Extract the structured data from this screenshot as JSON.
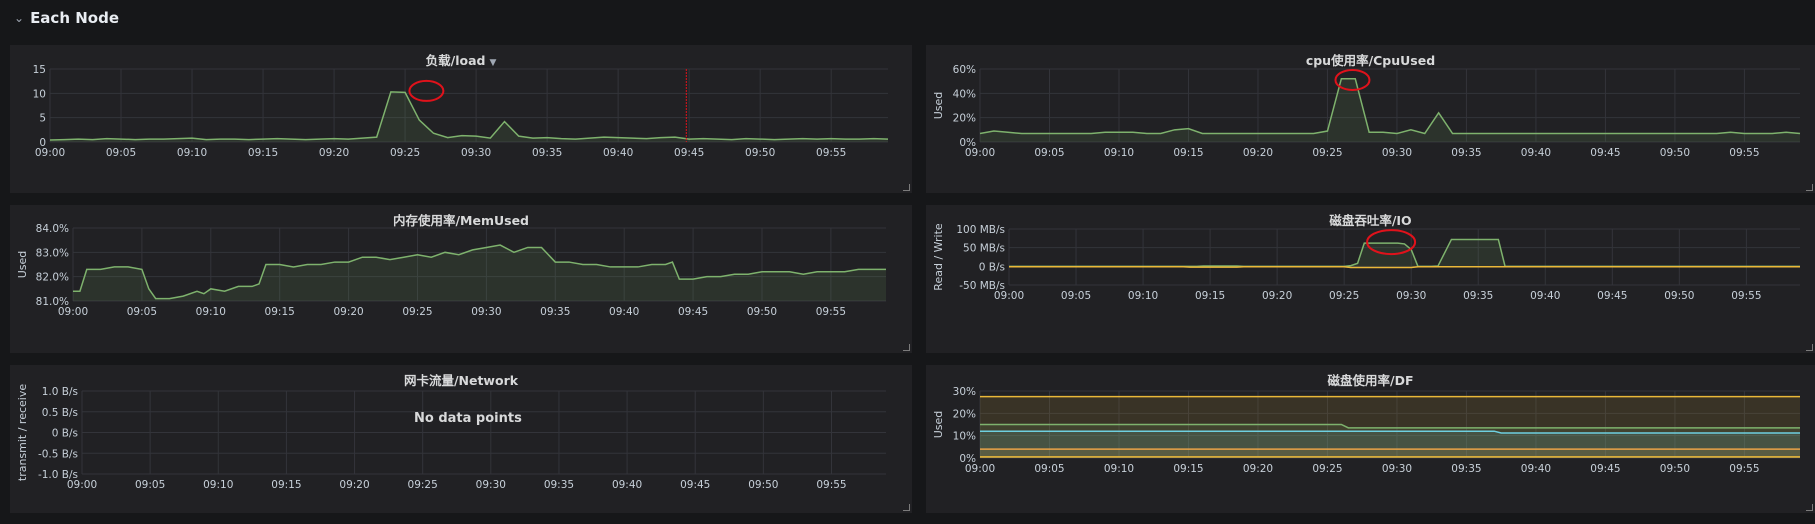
{
  "row": {
    "title": "Each Node",
    "icon": "chevron-down-icon"
  },
  "colors": {
    "green": "#7eb26d",
    "yellow": "#eab839",
    "blue": "#6ed0e0",
    "grid": "#33343a",
    "text": "#c7d0d9",
    "annotation": "#e0121b"
  },
  "panels": [
    {
      "id": "load",
      "title": "负载/load",
      "has_menu": true,
      "ylabel": "",
      "chart_data": {
        "type": "line",
        "yticks": [
          "0",
          "5",
          "10",
          "15"
        ],
        "ylim": [
          0,
          15
        ],
        "xticks": [
          "09:00",
          "09:05",
          "09:10",
          "09:15",
          "09:20",
          "09:25",
          "09:30",
          "09:35",
          "09:40",
          "09:45",
          "09:50",
          "09:55"
        ],
        "xlim_minutes": [
          0,
          59
        ],
        "series": [
          {
            "values_x": [
              0,
              1,
              2,
              3,
              4,
              5,
              6,
              7,
              8,
              9,
              10,
              11,
              12,
              13,
              14,
              15,
              16,
              17,
              18,
              19,
              20,
              21,
              22,
              23,
              24,
              25,
              26,
              27,
              28,
              29,
              30,
              31,
              32,
              33,
              34,
              35,
              36,
              37,
              38,
              39,
              40,
              41,
              42,
              43,
              44,
              45,
              46,
              47,
              48,
              49,
              50,
              51,
              52,
              53,
              54,
              55,
              56,
              57,
              58,
              59
            ],
            "values_y": [
              0.4,
              0.5,
              0.6,
              0.5,
              0.7,
              0.6,
              0.5,
              0.6,
              0.6,
              0.7,
              0.8,
              0.5,
              0.6,
              0.6,
              0.5,
              0.6,
              0.7,
              0.6,
              0.5,
              0.6,
              0.7,
              0.6,
              0.8,
              1.0,
              10.3,
              10.2,
              4.5,
              1.8,
              0.9,
              1.3,
              1.2,
              0.8,
              4.2,
              1.2,
              0.8,
              0.9,
              0.7,
              0.6,
              0.8,
              1.0,
              0.9,
              0.8,
              0.7,
              0.9,
              1.0,
              0.6,
              0.7,
              0.6,
              0.5,
              0.7,
              0.6,
              0.5,
              0.6,
              0.7,
              0.6,
              0.7,
              0.6,
              0.6,
              0.7,
              0.6
            ],
            "fill": true
          }
        ],
        "annotation_minute": 44.8,
        "circle_minute": 26.5,
        "circle_value": 10.5
      }
    },
    {
      "id": "cpu",
      "title": "cpu使用率/CpuUsed",
      "has_menu": false,
      "ylabel": "Used",
      "chart_data": {
        "type": "line",
        "yticks": [
          "0%",
          "20%",
          "40%",
          "60%"
        ],
        "ylim": [
          0,
          60
        ],
        "xticks": [
          "09:00",
          "09:05",
          "09:10",
          "09:15",
          "09:20",
          "09:25",
          "09:30",
          "09:35",
          "09:40",
          "09:45",
          "09:50",
          "09:55"
        ],
        "xlim_minutes": [
          0,
          59
        ],
        "series": [
          {
            "values_x": [
              0,
              1,
              2,
              3,
              4,
              5,
              6,
              7,
              8,
              9,
              10,
              11,
              12,
              13,
              14,
              15,
              16,
              17,
              18,
              19,
              20,
              21,
              22,
              23,
              24,
              25,
              26,
              27,
              28,
              29,
              30,
              31,
              32,
              33,
              34,
              35,
              36,
              37,
              38,
              39,
              40,
              41,
              42,
              43,
              44,
              45,
              46,
              47,
              48,
              49,
              50,
              51,
              52,
              53,
              54,
              55,
              56,
              57,
              58,
              59
            ],
            "values_y": [
              7,
              9,
              8,
              7,
              7,
              7,
              7,
              7,
              7,
              8,
              8,
              8,
              7,
              7,
              10,
              11,
              7,
              7,
              7,
              7,
              7,
              7,
              7,
              7,
              7,
              9,
              52,
              52,
              8,
              8,
              7,
              10,
              7,
              24,
              7,
              7,
              7,
              7,
              7,
              7,
              7,
              7,
              7,
              7,
              7,
              7,
              7,
              7,
              7,
              7,
              7,
              7,
              7,
              7,
              8,
              7,
              7,
              7,
              8,
              7
            ],
            "fill": true
          }
        ],
        "circle_minute": 26.8,
        "circle_value": 51
      }
    },
    {
      "id": "mem",
      "title": "内存使用率/MemUsed",
      "has_menu": false,
      "ylabel": "Used",
      "chart_data": {
        "type": "line",
        "yticks": [
          "81.0%",
          "82.0%",
          "83.0%",
          "84.0%"
        ],
        "ylim": [
          81,
          84
        ],
        "xticks": [
          "09:00",
          "09:05",
          "09:10",
          "09:15",
          "09:20",
          "09:25",
          "09:30",
          "09:35",
          "09:40",
          "09:45",
          "09:50",
          "09:55"
        ],
        "xlim_minutes": [
          0,
          59
        ],
        "series": [
          {
            "values_x": [
              0,
              0.5,
              1,
              2,
              3,
              4,
              5,
              5.5,
              6,
              7,
              8,
              9,
              9.5,
              10,
              11,
              12,
              13,
              13.5,
              14,
              15,
              16,
              17,
              18,
              19,
              20,
              21,
              22,
              23,
              24,
              25,
              26,
              27,
              28,
              29,
              30,
              31,
              32,
              33,
              34,
              35,
              36,
              37,
              38,
              39,
              40,
              41,
              42,
              43,
              43.5,
              44,
              45,
              46,
              47,
              48,
              49,
              50,
              51,
              52,
              53,
              54,
              55,
              56,
              57,
              58,
              59
            ],
            "values_y": [
              81.4,
              81.4,
              82.3,
              82.3,
              82.4,
              82.4,
              82.3,
              81.5,
              81.1,
              81.1,
              81.2,
              81.4,
              81.3,
              81.5,
              81.4,
              81.6,
              81.6,
              81.7,
              82.5,
              82.5,
              82.4,
              82.5,
              82.5,
              82.6,
              82.6,
              82.8,
              82.8,
              82.7,
              82.8,
              82.9,
              82.8,
              83.0,
              82.9,
              83.1,
              83.2,
              83.3,
              83.0,
              83.2,
              83.2,
              82.6,
              82.6,
              82.5,
              82.5,
              82.4,
              82.4,
              82.4,
              82.5,
              82.5,
              82.6,
              81.9,
              81.9,
              82.0,
              82.0,
              82.1,
              82.1,
              82.2,
              82.2,
              82.2,
              82.1,
              82.2,
              82.2,
              82.2,
              82.3,
              82.3,
              82.3
            ],
            "fill": true
          }
        ]
      }
    },
    {
      "id": "io",
      "title": "磁盘吞吐率/IO",
      "has_menu": false,
      "ylabel": "Read / Write",
      "chart_data": {
        "type": "line",
        "yticks": [
          "-50 MB/s",
          "0 B/s",
          "50 MB/s",
          "100 MB/s"
        ],
        "ylim": [
          -50,
          100
        ],
        "xticks": [
          "09:00",
          "09:05",
          "09:10",
          "09:15",
          "09:20",
          "09:25",
          "09:30",
          "09:35",
          "09:40",
          "09:45",
          "09:50",
          "09:55"
        ],
        "xlim_minutes": [
          0,
          59
        ],
        "series": [
          {
            "values_x": [
              0,
              14,
              14.5,
              17,
              17.5,
              25,
              25.5,
              26,
              26.5,
              29,
              29.5,
              30,
              30.5,
              31.5,
              32,
              33,
              33.5,
              36,
              36.5,
              37,
              59
            ],
            "values_y": [
              0,
              0,
              1,
              1,
              0,
              0,
              2,
              8,
              62,
              62,
              60,
              45,
              0,
              0,
              1,
              72,
              72,
              72,
              72,
              0,
              0
            ],
            "fill": true
          },
          {
            "values_x": [
              0,
              13,
              13.5,
              17,
              17.5,
              25,
              25.5,
              30,
              30.5,
              59
            ],
            "values_y": [
              -1,
              -1,
              -2,
              -2,
              -1,
              -1,
              -3,
              -3,
              -1,
              -1
            ],
            "fill": false,
            "color": "yellow"
          }
        ],
        "circle_minute": 28.5,
        "circle_value": 65
      }
    },
    {
      "id": "net",
      "title": "网卡流量/Network",
      "has_menu": false,
      "ylabel": "transmit / receive",
      "nodata": "No data points",
      "chart_data": {
        "type": "line",
        "yticks": [
          "-1.0 B/s",
          "-0.5 B/s",
          "0 B/s",
          "0.5 B/s",
          "1.0 B/s"
        ],
        "ylim": [
          -1,
          1
        ],
        "xticks": [
          "09:00",
          "09:05",
          "09:10",
          "09:15",
          "09:20",
          "09:25",
          "09:30",
          "09:35",
          "09:40",
          "09:45",
          "09:50",
          "09:55"
        ],
        "xlim_minutes": [
          0,
          59
        ],
        "series": []
      }
    },
    {
      "id": "df",
      "title": "磁盘使用率/DF",
      "has_menu": false,
      "ylabel": "Used",
      "chart_data": {
        "type": "line",
        "yticks": [
          "0%",
          "10%",
          "20%",
          "30%"
        ],
        "ylim": [
          0,
          30
        ],
        "xticks": [
          "09:00",
          "09:05",
          "09:10",
          "09:15",
          "09:20",
          "09:25",
          "09:30",
          "09:35",
          "09:40",
          "09:45",
          "09:50",
          "09:55"
        ],
        "xlim_minutes": [
          0,
          59
        ],
        "series": [
          {
            "values_x": [
              0,
              59
            ],
            "values_y": [
              27.5,
              27.5
            ],
            "fill": true,
            "color": "yellow"
          },
          {
            "values_x": [
              0,
              26,
              26.5,
              59
            ],
            "values_y": [
              15,
              15,
              13.5,
              13.5
            ],
            "fill": true,
            "color": "green"
          },
          {
            "values_x": [
              0,
              37,
              37.5,
              59
            ],
            "values_y": [
              12,
              12,
              11.2,
              11.2
            ],
            "fill": true,
            "color": "blue"
          },
          {
            "values_x": [
              0,
              59
            ],
            "values_y": [
              4,
              4
            ],
            "fill": true,
            "color": "orange"
          },
          {
            "values_x": [
              0,
              59
            ],
            "values_y": [
              0.5,
              0.5
            ],
            "fill": false,
            "color": "yellow"
          }
        ]
      }
    }
  ]
}
